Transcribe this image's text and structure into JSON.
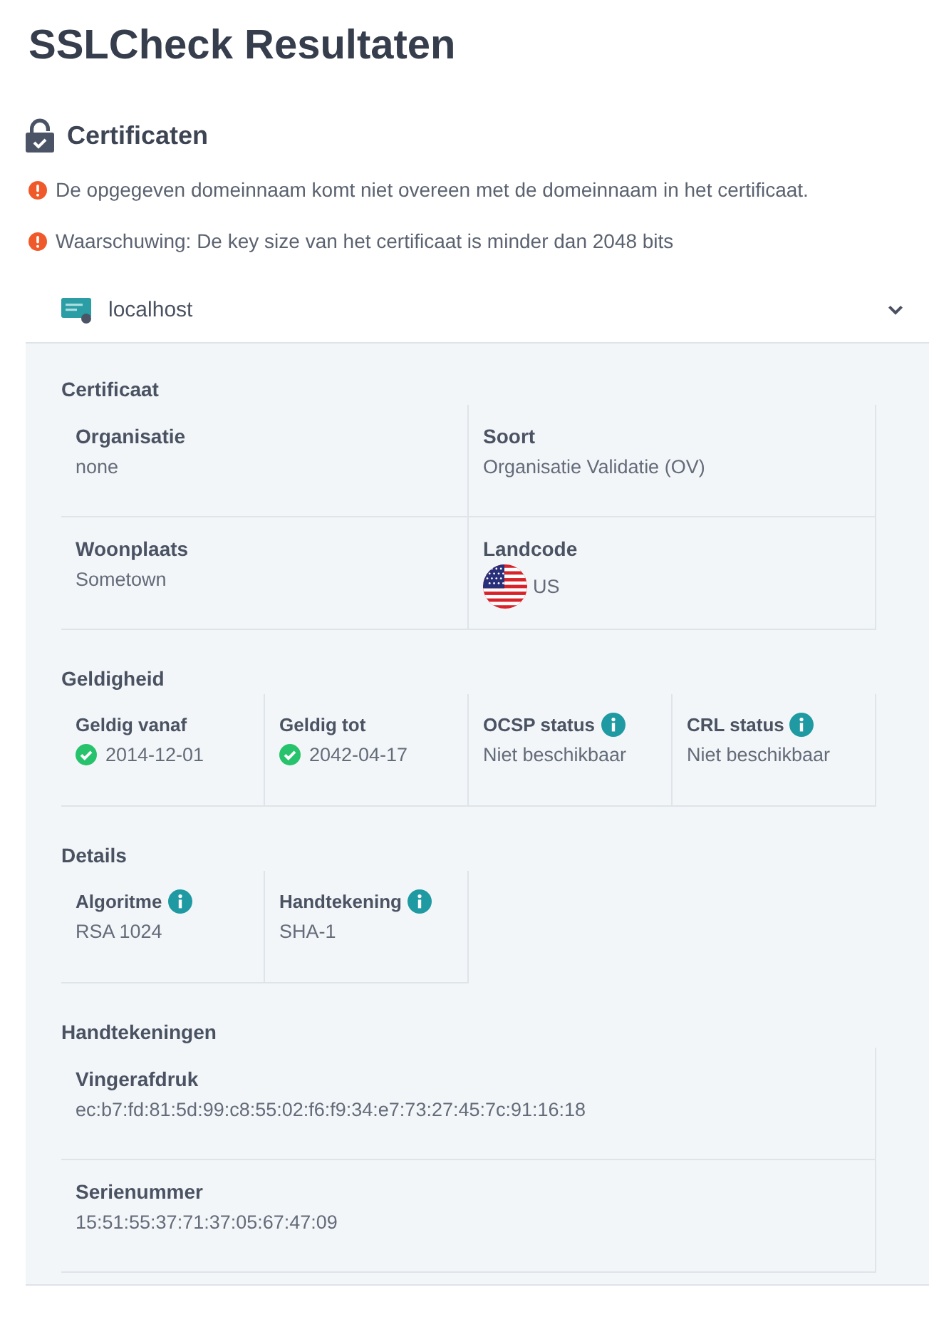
{
  "title": "SSLCheck Resultaten",
  "section": {
    "title": "Certificaten",
    "warnings": [
      "De opgegeven domeinnaam komt niet overeen met de domeinnaam in het certificaat.",
      "Waarschuwing: De key size van het certificaat is minder dan 2048 bits"
    ],
    "certificates": [
      {
        "name": "localhost",
        "expanded": true,
        "groups": [
          {
            "title": "Certificaat",
            "fields": [
              {
                "label": "Organisatie",
                "value": "none",
                "kind": "text",
                "info": false,
                "verified": false
              },
              {
                "label": "Soort",
                "value": "Organisatie Validatie (OV)",
                "kind": "text",
                "info": false,
                "verified": false
              },
              {
                "label": "Woonplaats",
                "value": "Sometown",
                "kind": "text",
                "info": false,
                "verified": false
              },
              {
                "label": "Landcode",
                "value": "US",
                "kind": "country",
                "info": false,
                "verified": false
              }
            ]
          },
          {
            "title": "Geldigheid",
            "fields": [
              {
                "label": "Geldig vanaf",
                "value": "2014-12-01",
                "kind": "text",
                "info": false,
                "verified": true
              },
              {
                "label": "Geldig tot",
                "value": "2042-04-17",
                "kind": "text",
                "info": false,
                "verified": true
              },
              {
                "label": "OCSP status",
                "value": "Niet beschikbaar",
                "kind": "text",
                "info": true,
                "verified": false
              },
              {
                "label": "CRL status",
                "value": "Niet beschikbaar",
                "kind": "text",
                "info": true,
                "verified": false
              }
            ]
          },
          {
            "title": "Details",
            "fields": [
              {
                "label": "Algoritme",
                "value": "RSA 1024",
                "kind": "text",
                "info": true,
                "verified": false
              },
              {
                "label": "Handtekening",
                "value": "SHA-1",
                "kind": "text",
                "info": true,
                "verified": false
              }
            ]
          },
          {
            "title": "Handtekeningen",
            "fields": [
              {
                "label": "Vingerafdruk",
                "value": "ec:b7:fd:81:5d:99:c8:55:02:f6:f9:34:e7:73:27:45:7c:91:16:18",
                "kind": "text",
                "info": false,
                "verified": false
              },
              {
                "label": "Serienummer",
                "value": "15:51:55:37:71:37:05:67:47:09",
                "kind": "text",
                "info": false,
                "verified": false
              }
            ]
          }
        ]
      }
    ]
  }
}
